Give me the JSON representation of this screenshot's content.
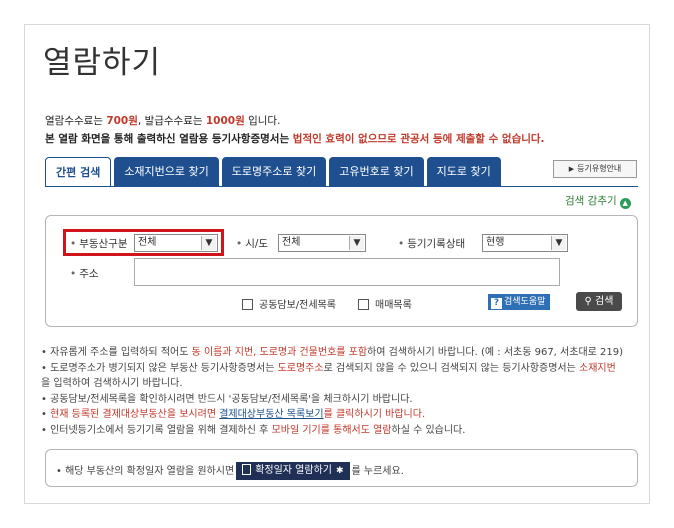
{
  "page": {
    "title": "열람하기"
  },
  "notice": {
    "fee_prefix": "열람수수료는 ",
    "view_fee": "700원",
    "fee_mid": ", 발급수수료는 ",
    "issue_fee": "1000원",
    "fee_suffix": " 입니다.",
    "warn_prefix": "본 열람 화면을 통해 출력하신 열람용 등기사항증명서는 ",
    "warn_text": "법적인 효력이 없으므로 관공서 등에 제출할 수 없습니다."
  },
  "tabs": [
    {
      "label": "간편 검색",
      "active": true
    },
    {
      "label": "소재지번으로 찾기",
      "active": false
    },
    {
      "label": "도로명주소로 찾기",
      "active": false
    },
    {
      "label": "고유번호로 찾기",
      "active": false
    },
    {
      "label": "지도로 찾기",
      "active": false
    }
  ],
  "guide_button": {
    "label": "등기유형안내"
  },
  "collapse_link": {
    "label": "검색 감추기"
  },
  "search_form": {
    "property_type": {
      "label": "부동산구분",
      "value": "전체"
    },
    "region": {
      "label": "시/도",
      "value": "전체"
    },
    "record_status": {
      "label": "등기기록상태",
      "value": "현행"
    },
    "address": {
      "label": "주소",
      "value": ""
    },
    "checkboxes": [
      {
        "label": "공동담보/전세목록",
        "checked": false
      },
      {
        "label": "매매목록",
        "checked": false
      }
    ],
    "help_button": {
      "label": "검색도움말"
    },
    "search_button": {
      "label": "검색"
    }
  },
  "bullets": {
    "b1a": "자유롭게 주소를 입력하되 적어도 ",
    "b1b": "동 이름과 지번, 도로명과 건물번호를 포함",
    "b1c": "하여 검색하시기 바랍니다. (예 : 서초동 967, 서초대로 219)",
    "b2a": "도로명주소가 병기되지 않은 부동산 등기사항증명서는 ",
    "b2b": "도로명주소",
    "b2c": "로 검색되지 않을 수 있으니 검색되지 않는 등기사항증명서는 ",
    "b2d": "소재지번",
    "b2e": "을 입력하여 검색하시기 바랍니다.",
    "b3": "공동담보/전세목록을 확인하시려면 반드시 '공동담보/전세목록'을 체크하시기 바랍니다.",
    "b4a": "현재 등록된 결제대상부동산을 보시려면 ",
    "b4b": "결제대상부동산 목록보기",
    "b4c": "를 클릭하시기 바랍니다.",
    "b5a": "인터넷등기소에서 등기기록 열람을 위해 결제하신 후 ",
    "b5b": "모바일 기기를 통해서도 열람",
    "b5c": "하실 수 있습니다."
  },
  "confirm": {
    "prefix": "• 해당 부동산의 확정일자 열람을 원하시면",
    "button_label": "확정일자 열람하기",
    "suffix": "를 누르세요."
  }
}
